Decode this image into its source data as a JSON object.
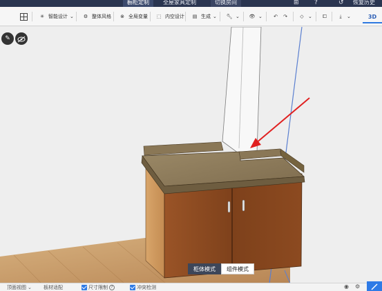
{
  "topnav": {
    "tabs": [
      "橱柜定制",
      "全屋家具定制",
      "切换房间"
    ],
    "active_tab": "橱柜定制",
    "restore_history": "恢复历史"
  },
  "toolbar": {
    "items": [
      {
        "label": "智能设计",
        "icon": "sparkle-icon",
        "dropdown": true
      },
      {
        "label": "整体风格",
        "icon": "style-icon",
        "dropdown": false
      },
      {
        "label": "全局变量",
        "icon": "globe-icon",
        "dropdown": false
      },
      {
        "label": "内空设计",
        "icon": "frame-icon",
        "dropdown": false
      },
      {
        "label": "生成",
        "icon": "generate-icon",
        "dropdown": true
      }
    ],
    "view_3d": "3D"
  },
  "mode_switch": {
    "options": [
      "柜体模式",
      "组件模式"
    ],
    "active": "柜体模式"
  },
  "statusbar": {
    "items": [
      "顶面视图",
      "板材适配",
      "尺寸限制",
      "冲突检测"
    ]
  },
  "colors": {
    "topnav_bg": "#2a3550",
    "accent": "#2f7be6",
    "arrow": "#e02020",
    "wood_door": "#8a4a22",
    "countertop": "#8c7a5c",
    "floor": "#c49a6a"
  }
}
